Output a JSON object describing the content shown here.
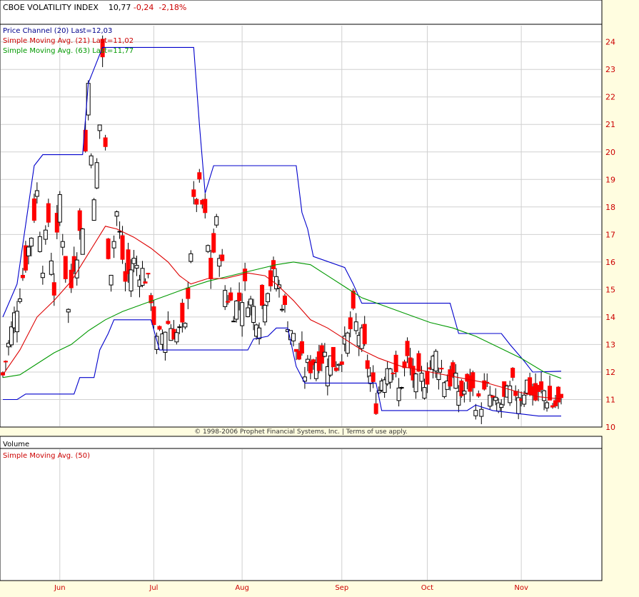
{
  "header": {
    "name": "CBOE VOLATILITY INDEX",
    "last": "10,77",
    "change": "-0,24",
    "change_pct": "-2,18%"
  },
  "legends": [
    {
      "text": "Price Channel (20) Last=12,03",
      "color": "#00008b"
    },
    {
      "text": "Simple Moving Avg. (21) Last=11,02",
      "color": "#cc0000"
    },
    {
      "text": "Simple Moving Avg. (63) Last=11,77",
      "color": "#009900"
    }
  ],
  "copyright": "© 1998-2006 Prophet Financial Systems, Inc. | Terms of use apply.",
  "volume_panel": {
    "title": "Volume",
    "legend": "Simple Moving Avg. (50)"
  },
  "colors": {
    "background": "#fffde0",
    "plot_bg": "#ffffff",
    "grid": "#d0d0d0",
    "up_candle": "#ffffff",
    "down_candle": "#ff0000",
    "channel": "#0000cc",
    "sma21": "#dd0000",
    "sma63": "#009900",
    "axis_text": "#cc0000"
  },
  "chart_data": {
    "type": "candlestick",
    "ylim": [
      10,
      24.9
    ],
    "yticks": [
      10,
      11,
      12,
      13,
      14,
      15,
      16,
      17,
      18,
      19,
      20,
      21,
      22,
      23,
      24
    ],
    "month_labels": [
      {
        "label": "Jun",
        "index": 22
      },
      {
        "label": "Jul",
        "index": 55
      },
      {
        "label": "Aug",
        "index": 86
      },
      {
        "label": "Sep",
        "index": 121
      },
      {
        "label": "Oct",
        "index": 151
      },
      {
        "label": "Nov",
        "index": 184
      }
    ],
    "n_days": 197,
    "ohlc_keys": [
      {
        "i": 0,
        "c": 11.9
      },
      {
        "i": 3,
        "c": 13.5
      },
      {
        "i": 6,
        "c": 15.0
      },
      {
        "i": 10,
        "c": 17.0
      },
      {
        "i": 12,
        "c": 18.5
      },
      {
        "i": 14,
        "c": 16.0
      },
      {
        "i": 16,
        "c": 17.5
      },
      {
        "i": 18,
        "c": 15.0
      },
      {
        "i": 20,
        "c": 18.4
      },
      {
        "i": 23,
        "c": 14.2
      },
      {
        "i": 25,
        "c": 16.0
      },
      {
        "i": 28,
        "c": 17.5
      },
      {
        "i": 30,
        "c": 22.5
      },
      {
        "i": 32,
        "c": 18.0
      },
      {
        "i": 34,
        "c": 21.0
      },
      {
        "i": 35,
        "c": 23.5
      },
      {
        "i": 37,
        "c": 16.5
      },
      {
        "i": 38,
        "c": 15.8
      },
      {
        "i": 40,
        "c": 17.8
      },
      {
        "i": 43,
        "c": 15.3
      },
      {
        "i": 46,
        "c": 16.0
      },
      {
        "i": 50,
        "c": 15.5
      },
      {
        "i": 52,
        "c": 14.8
      },
      {
        "i": 54,
        "c": 13.0
      },
      {
        "i": 58,
        "c": 13.8
      },
      {
        "i": 61,
        "c": 13.4
      },
      {
        "i": 64,
        "c": 13.5
      },
      {
        "i": 67,
        "c": 18.0
      },
      {
        "i": 69,
        "c": 18.6
      },
      {
        "i": 71,
        "c": 17.5
      },
      {
        "i": 73,
        "c": 15.5
      },
      {
        "i": 75,
        "c": 17.3
      },
      {
        "i": 78,
        "c": 15.0
      },
      {
        "i": 81,
        "c": 14.3
      },
      {
        "i": 85,
        "c": 15.0
      },
      {
        "i": 88,
        "c": 14.3
      },
      {
        "i": 90,
        "c": 14.0
      },
      {
        "i": 93,
        "c": 15.2
      },
      {
        "i": 96,
        "c": 15.5
      },
      {
        "i": 99,
        "c": 14.2
      },
      {
        "i": 101,
        "c": 13.6
      },
      {
        "i": 103,
        "c": 12.8
      },
      {
        "i": 106,
        "c": 12.0
      },
      {
        "i": 109,
        "c": 12.4
      },
      {
        "i": 113,
        "c": 12.6
      },
      {
        "i": 117,
        "c": 12.3
      },
      {
        "i": 120,
        "c": 12.9
      },
      {
        "i": 123,
        "c": 13.9
      },
      {
        "i": 126,
        "c": 13.2
      },
      {
        "i": 129,
        "c": 11.8
      },
      {
        "i": 131,
        "c": 10.9
      },
      {
        "i": 133,
        "c": 11.8
      },
      {
        "i": 136,
        "c": 12.5
      },
      {
        "i": 139,
        "c": 11.3
      },
      {
        "i": 142,
        "c": 12.4
      },
      {
        "i": 145,
        "c": 11.5
      },
      {
        "i": 149,
        "c": 11.9
      },
      {
        "i": 152,
        "c": 12.6
      },
      {
        "i": 155,
        "c": 11.8
      },
      {
        "i": 158,
        "c": 11.7
      },
      {
        "i": 161,
        "c": 11.2
      },
      {
        "i": 164,
        "c": 11.5
      },
      {
        "i": 167,
        "c": 10.8
      },
      {
        "i": 170,
        "c": 11.3
      },
      {
        "i": 173,
        "c": 10.7
      },
      {
        "i": 176,
        "c": 10.9
      },
      {
        "i": 179,
        "c": 11.4
      },
      {
        "i": 182,
        "c": 11.2
      },
      {
        "i": 184,
        "c": 11.6
      },
      {
        "i": 187,
        "c": 11.0
      },
      {
        "i": 190,
        "c": 11.3
      },
      {
        "i": 193,
        "c": 10.8
      },
      {
        "i": 196,
        "c": 10.77
      }
    ],
    "channel_upper": [
      {
        "i": 0,
        "v": 14.0
      },
      {
        "i": 5,
        "v": 15.2
      },
      {
        "i": 11,
        "v": 19.5
      },
      {
        "i": 14,
        "v": 19.9
      },
      {
        "i": 28,
        "v": 19.9
      },
      {
        "i": 30,
        "v": 22.5
      },
      {
        "i": 35,
        "v": 23.8
      },
      {
        "i": 67,
        "v": 23.8
      },
      {
        "i": 69,
        "v": 21.0
      },
      {
        "i": 71,
        "v": 18.5
      },
      {
        "i": 74,
        "v": 19.5
      },
      {
        "i": 103,
        "v": 19.5
      },
      {
        "i": 105,
        "v": 17.8
      },
      {
        "i": 107,
        "v": 17.2
      },
      {
        "i": 109,
        "v": 16.2
      },
      {
        "i": 120,
        "v": 15.8
      },
      {
        "i": 123,
        "v": 15.2
      },
      {
        "i": 126,
        "v": 14.5
      },
      {
        "i": 157,
        "v": 14.5
      },
      {
        "i": 160,
        "v": 13.4
      },
      {
        "i": 175,
        "v": 13.4
      },
      {
        "i": 178,
        "v": 13.0
      },
      {
        "i": 183,
        "v": 12.4
      },
      {
        "i": 186,
        "v": 12.0
      },
      {
        "i": 196,
        "v": 12.03
      }
    ],
    "channel_lower": [
      {
        "i": 0,
        "v": 11.0
      },
      {
        "i": 5,
        "v": 11.0
      },
      {
        "i": 8,
        "v": 11.2
      },
      {
        "i": 22,
        "v": 11.2
      },
      {
        "i": 25,
        "v": 11.2
      },
      {
        "i": 27,
        "v": 11.8
      },
      {
        "i": 32,
        "v": 11.8
      },
      {
        "i": 34,
        "v": 12.8
      },
      {
        "i": 37,
        "v": 13.4
      },
      {
        "i": 39,
        "v": 13.9
      },
      {
        "i": 52,
        "v": 13.9
      },
      {
        "i": 55,
        "v": 12.8
      },
      {
        "i": 86,
        "v": 12.8
      },
      {
        "i": 88,
        "v": 13.2
      },
      {
        "i": 93,
        "v": 13.3
      },
      {
        "i": 96,
        "v": 13.6
      },
      {
        "i": 100,
        "v": 13.6
      },
      {
        "i": 103,
        "v": 12.2
      },
      {
        "i": 106,
        "v": 11.6
      },
      {
        "i": 131,
        "v": 11.6
      },
      {
        "i": 133,
        "v": 10.6
      },
      {
        "i": 163,
        "v": 10.6
      },
      {
        "i": 166,
        "v": 10.8
      },
      {
        "i": 172,
        "v": 10.6
      },
      {
        "i": 188,
        "v": 10.4
      },
      {
        "i": 196,
        "v": 10.4
      }
    ],
    "sma21": [
      {
        "i": 0,
        "v": 11.9
      },
      {
        "i": 6,
        "v": 12.8
      },
      {
        "i": 12,
        "v": 14.0
      },
      {
        "i": 18,
        "v": 14.6
      },
      {
        "i": 24,
        "v": 15.3
      },
      {
        "i": 30,
        "v": 16.3
      },
      {
        "i": 36,
        "v": 17.3
      },
      {
        "i": 40,
        "v": 17.2
      },
      {
        "i": 46,
        "v": 16.9
      },
      {
        "i": 52,
        "v": 16.5
      },
      {
        "i": 58,
        "v": 16.0
      },
      {
        "i": 62,
        "v": 15.5
      },
      {
        "i": 66,
        "v": 15.2
      },
      {
        "i": 72,
        "v": 15.4
      },
      {
        "i": 78,
        "v": 15.4
      },
      {
        "i": 86,
        "v": 15.6
      },
      {
        "i": 92,
        "v": 15.5
      },
      {
        "i": 96,
        "v": 15.2
      },
      {
        "i": 102,
        "v": 14.6
      },
      {
        "i": 108,
        "v": 13.9
      },
      {
        "i": 114,
        "v": 13.6
      },
      {
        "i": 120,
        "v": 13.2
      },
      {
        "i": 126,
        "v": 12.8
      },
      {
        "i": 132,
        "v": 12.5
      },
      {
        "i": 140,
        "v": 12.2
      },
      {
        "i": 150,
        "v": 12.0
      },
      {
        "i": 160,
        "v": 11.8
      },
      {
        "i": 170,
        "v": 11.6
      },
      {
        "i": 180,
        "v": 11.3
      },
      {
        "i": 188,
        "v": 11.1
      },
      {
        "i": 196,
        "v": 11.02
      }
    ],
    "sma63": [
      {
        "i": 0,
        "v": 11.8
      },
      {
        "i": 6,
        "v": 11.9
      },
      {
        "i": 12,
        "v": 12.3
      },
      {
        "i": 18,
        "v": 12.7
      },
      {
        "i": 24,
        "v": 13.0
      },
      {
        "i": 30,
        "v": 13.5
      },
      {
        "i": 36,
        "v": 13.9
      },
      {
        "i": 42,
        "v": 14.2
      },
      {
        "i": 50,
        "v": 14.5
      },
      {
        "i": 58,
        "v": 14.8
      },
      {
        "i": 66,
        "v": 15.1
      },
      {
        "i": 72,
        "v": 15.3
      },
      {
        "i": 80,
        "v": 15.5
      },
      {
        "i": 88,
        "v": 15.7
      },
      {
        "i": 96,
        "v": 15.9
      },
      {
        "i": 102,
        "v": 16.0
      },
      {
        "i": 108,
        "v": 15.9
      },
      {
        "i": 114,
        "v": 15.5
      },
      {
        "i": 120,
        "v": 15.1
      },
      {
        "i": 126,
        "v": 14.7
      },
      {
        "i": 134,
        "v": 14.4
      },
      {
        "i": 142,
        "v": 14.1
      },
      {
        "i": 150,
        "v": 13.8
      },
      {
        "i": 158,
        "v": 13.6
      },
      {
        "i": 166,
        "v": 13.3
      },
      {
        "i": 174,
        "v": 12.9
      },
      {
        "i": 182,
        "v": 12.5
      },
      {
        "i": 190,
        "v": 12.0
      },
      {
        "i": 196,
        "v": 11.77
      }
    ]
  }
}
